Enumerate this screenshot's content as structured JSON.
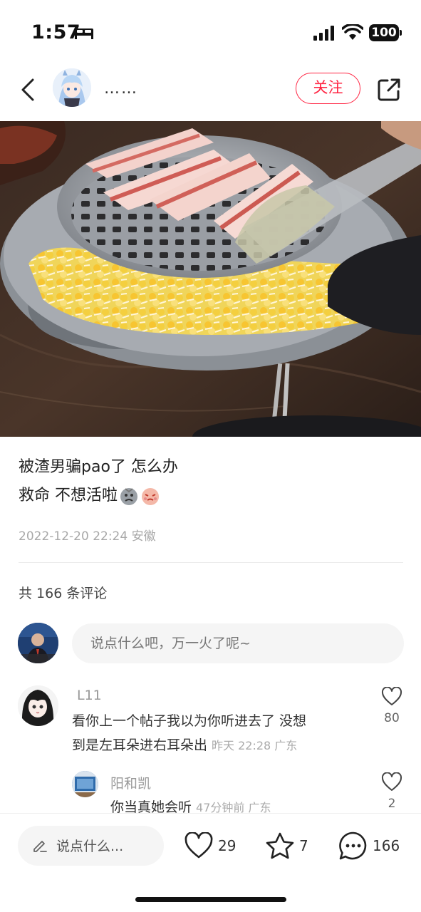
{
  "status_bar": {
    "time": "1:57",
    "battery": "100"
  },
  "header": {
    "username": "……",
    "follow_label": "关注"
  },
  "post": {
    "line1": "被渣男骗pao了 怎么办",
    "line2": "救命  不想活啦",
    "date_location": "2022-12-20 22:24 安徽",
    "comment_count_label": "共 166 条评论"
  },
  "comment_input": {
    "placeholder": "说点什么吧，万一火了呢~"
  },
  "comments": [
    {
      "name": "L11",
      "text_line1": "看你上一个帖子我以为你听进去了 没想",
      "text_line2": "到是左耳朵进右耳朵出",
      "meta": "昨天 22:28 广东",
      "likes": "80"
    },
    {
      "name": "阳和凯",
      "text": "你当真她会听",
      "meta": "47分钟前 广东",
      "likes": "2"
    }
  ],
  "bottom_bar": {
    "input_placeholder": "说点什么...",
    "likes": "29",
    "stars": "7",
    "comments": "166"
  },
  "icons": {
    "back": "chevron-left-icon",
    "share": "share-icon",
    "like": "heart-icon",
    "collect": "star-icon",
    "comment": "chat-bubble-icon",
    "edit": "pencil-icon"
  },
  "colors": {
    "accent": "#ff2442",
    "muted_text": "#a8a8a8"
  }
}
